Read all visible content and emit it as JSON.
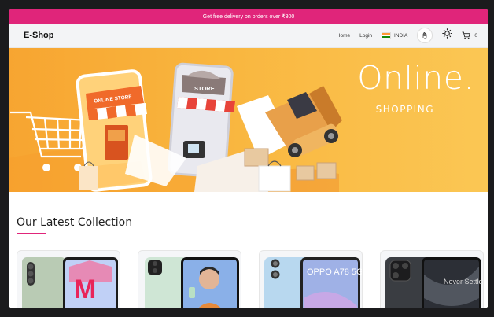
{
  "promo": {
    "text": "Get free delivery on orders over ₹300"
  },
  "nav": {
    "brand": "E-Shop",
    "home": "Home",
    "login": "Login",
    "country": "INDIA",
    "cart_count": "0"
  },
  "banner": {
    "title": "Online.",
    "subtitle": "SHOPPING",
    "shop_sign_1": "ONLINE STORE",
    "shop_sign_2": "STORE"
  },
  "collection": {
    "title": "Our Latest Collection",
    "products": [
      {
        "screen_text": "M"
      },
      {
        "screen_text": ""
      },
      {
        "screen_text": "OPPO A78 5G"
      },
      {
        "screen_text": "Never Settle"
      }
    ]
  },
  "colors": {
    "accent": "#e0257a",
    "banner": "#f9b63f"
  }
}
